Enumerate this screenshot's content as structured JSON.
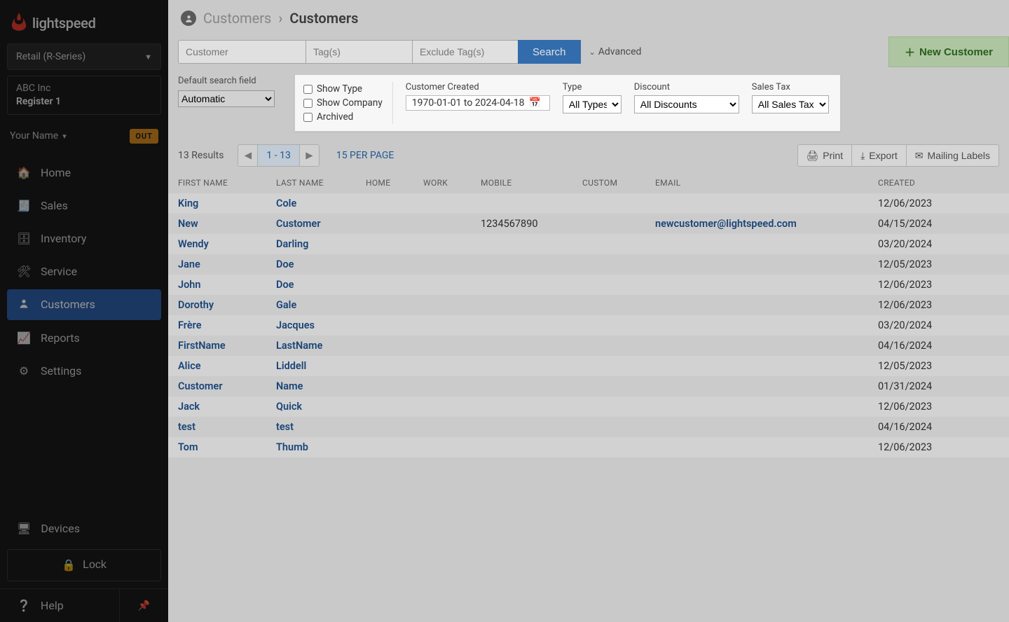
{
  "brand": {
    "name": "lightspeed"
  },
  "retail_selector": "Retail (R-Series)",
  "company": {
    "name": "ABC Inc",
    "register": "Register 1"
  },
  "user": {
    "name": "Your Name",
    "status_badge": "OUT"
  },
  "nav": {
    "items": [
      {
        "id": "home",
        "label": "Home"
      },
      {
        "id": "sales",
        "label": "Sales"
      },
      {
        "id": "inventory",
        "label": "Inventory"
      },
      {
        "id": "service",
        "label": "Service"
      },
      {
        "id": "customers",
        "label": "Customers"
      },
      {
        "id": "reports",
        "label": "Reports"
      },
      {
        "id": "settings",
        "label": "Settings"
      }
    ],
    "devices": "Devices",
    "lock": "Lock",
    "help": "Help"
  },
  "breadcrumb": {
    "parent": "Customers",
    "current": "Customers"
  },
  "search": {
    "customer_placeholder": "Customer",
    "tag_placeholder": "Tag(s)",
    "exclude_placeholder": "Exclude Tag(s)",
    "button": "Search",
    "advanced_toggle": "Advanced",
    "new_customer": "New Customer"
  },
  "advanced": {
    "default_field_label": "Default search field",
    "default_field_value": "Automatic",
    "show_type": "Show Type",
    "show_company": "Show Company",
    "archived": "Archived",
    "customer_created_label": "Customer Created",
    "customer_created_value": "1970-01-01 to 2024-04-18",
    "type_label": "Type",
    "type_value": "All Types",
    "discount_label": "Discount",
    "discount_value": "All Discounts",
    "sales_tax_label": "Sales Tax",
    "sales_tax_value": "All Sales Taxes"
  },
  "results": {
    "count_text": "13 Results",
    "range": "1 - 13",
    "per_page": "15 PER PAGE",
    "print": "Print",
    "export": "Export",
    "mailing": "Mailing Labels"
  },
  "table": {
    "headers": {
      "first": "FIRST NAME",
      "last": "LAST NAME",
      "home": "HOME",
      "work": "WORK",
      "mobile": "MOBILE",
      "custom": "CUSTOM",
      "email": "EMAIL",
      "created": "CREATED"
    },
    "rows": [
      {
        "first": "King",
        "last": "Cole",
        "mobile": "",
        "email": "",
        "created": "12/06/2023"
      },
      {
        "first": "New",
        "last": "Customer",
        "mobile": "1234567890",
        "email": "newcustomer@lightspeed.com",
        "created": "04/15/2024"
      },
      {
        "first": "Wendy",
        "last": "Darling",
        "mobile": "",
        "email": "",
        "created": "03/20/2024"
      },
      {
        "first": "Jane",
        "last": "Doe",
        "mobile": "",
        "email": "",
        "created": "12/05/2023"
      },
      {
        "first": "John",
        "last": "Doe",
        "mobile": "",
        "email": "",
        "created": "12/06/2023"
      },
      {
        "first": "Dorothy",
        "last": "Gale",
        "mobile": "",
        "email": "",
        "created": "12/06/2023"
      },
      {
        "first": "Frère",
        "last": "Jacques",
        "mobile": "",
        "email": "",
        "created": "03/20/2024"
      },
      {
        "first": "FirstName",
        "last": "LastName",
        "mobile": "",
        "email": "",
        "created": "04/16/2024"
      },
      {
        "first": "Alice",
        "last": "Liddell",
        "mobile": "",
        "email": "",
        "created": "12/05/2023"
      },
      {
        "first": "Customer",
        "last": "Name",
        "mobile": "",
        "email": "",
        "created": "01/31/2024"
      },
      {
        "first": "Jack",
        "last": "Quick",
        "mobile": "",
        "email": "",
        "created": "12/06/2023"
      },
      {
        "first": "test",
        "last": "test",
        "mobile": "",
        "email": "",
        "created": "04/16/2024"
      },
      {
        "first": "Tom",
        "last": "Thumb",
        "mobile": "",
        "email": "",
        "created": "12/06/2023"
      }
    ]
  }
}
